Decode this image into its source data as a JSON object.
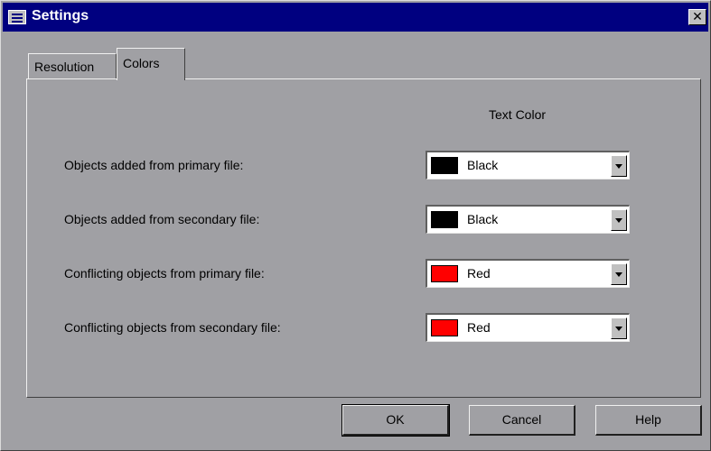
{
  "window": {
    "title": "Settings",
    "icon": "window-settings-icon",
    "close_label": "✕"
  },
  "tabs": [
    {
      "label": "Resolution",
      "active": false
    },
    {
      "label": "Colors",
      "active": true
    }
  ],
  "colors_panel": {
    "column_header": "Text Color",
    "rows": [
      {
        "label": "Objects added from primary file:",
        "value": "Black",
        "swatch": "#000000"
      },
      {
        "label": "Objects added from secondary file:",
        "value": "Black",
        "swatch": "#000000"
      },
      {
        "label": "Conflicting objects from primary file:",
        "value": "Red",
        "swatch": "#ff0000"
      },
      {
        "label": "Conflicting objects from secondary file:",
        "value": "Red",
        "swatch": "#ff0000"
      }
    ]
  },
  "buttons": {
    "ok": "OK",
    "cancel": "Cancel",
    "help": "Help"
  },
  "theme": {
    "titlebar": "#000080",
    "face": "#a0a0a4"
  }
}
